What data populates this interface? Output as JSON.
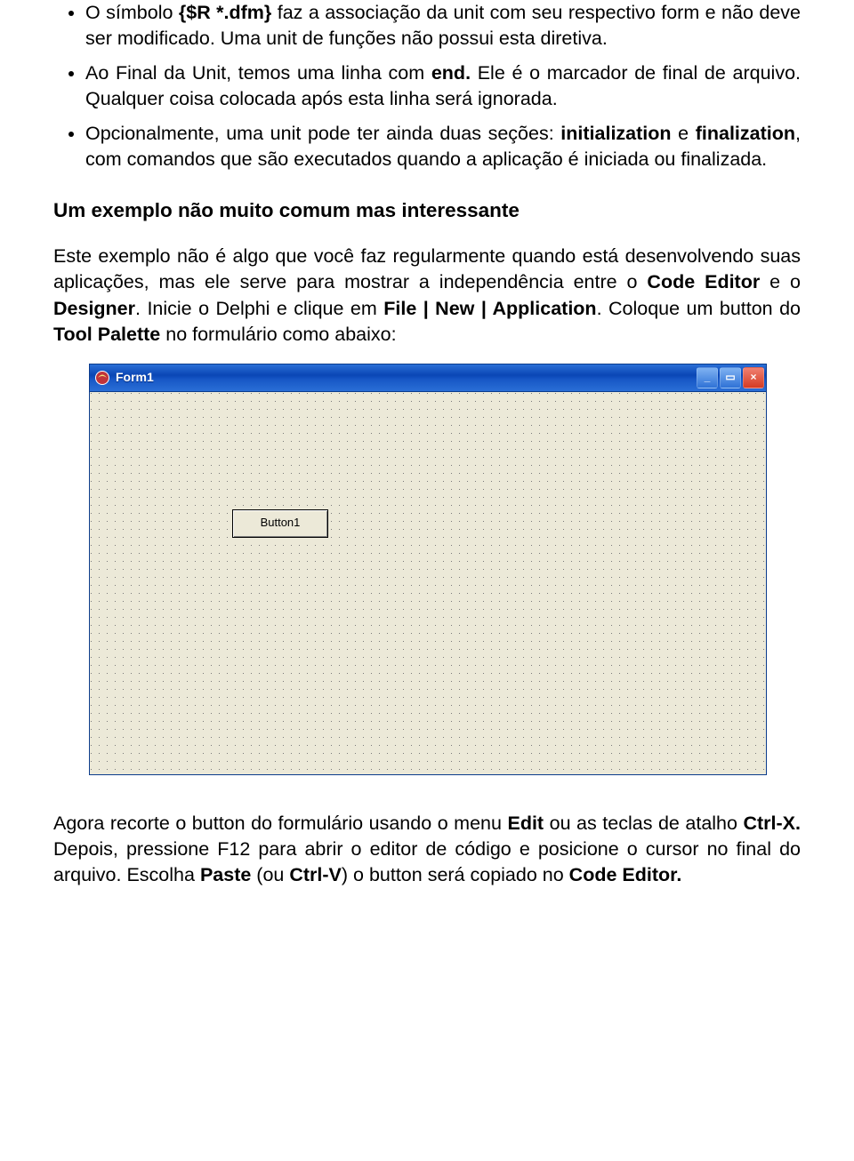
{
  "bullets": [
    {
      "lead": "O símbolo ",
      "bold1": "{$R *.dfm}",
      "rest": " faz a associação da unit com seu respectivo form e não deve ser modificado. Uma unit de funções não possui esta diretiva."
    },
    {
      "lead": "Ao Final da Unit, temos uma linha com ",
      "bold1": "end.",
      "rest": " Ele é o marcador de final de arquivo. Qualquer coisa colocada após esta linha será ignorada."
    },
    {
      "lead": "Opcionalmente, uma unit pode ter ainda duas seções: ",
      "bold1": "initialization",
      "mid": " e ",
      "bold2": "finalization",
      "rest": ", com comandos que são executados quando a aplicação é iniciada ou finalizada."
    }
  ],
  "heading": "Um exemplo não muito comum mas interessante",
  "para1": {
    "t0": "Este exemplo não é algo que você faz regularmente quando está desenvolvendo suas aplicações, mas ele serve para mostrar a independência entre o ",
    "b1": "Code Editor",
    "t1": " e o ",
    "b2": "Designer",
    "t2": ". Inicie o Delphi e clique em ",
    "b3": "File | New | Application",
    "t3": ". Coloque um button do ",
    "b4": "Tool Palette",
    "t4": " no formulário como abaixo:"
  },
  "window": {
    "title": "Form1",
    "button_label": "Button1",
    "minimize_glyph": "_",
    "maximize_glyph": "▭",
    "close_glyph": "×"
  },
  "para2": {
    "t0": "Agora recorte o button do formulário usando o menu ",
    "b1": "Edit",
    "t1": " ou as teclas de atalho ",
    "b2": "Ctrl-X.",
    "t2": " Depois, pressione F12 para abrir o editor de código e posicione o cursor no final do arquivo. Escolha ",
    "b3": "Paste",
    "t3": " (ou ",
    "b4": "Ctrl-V",
    "t4": ") o button será copiado no ",
    "b5": "Code Editor."
  }
}
